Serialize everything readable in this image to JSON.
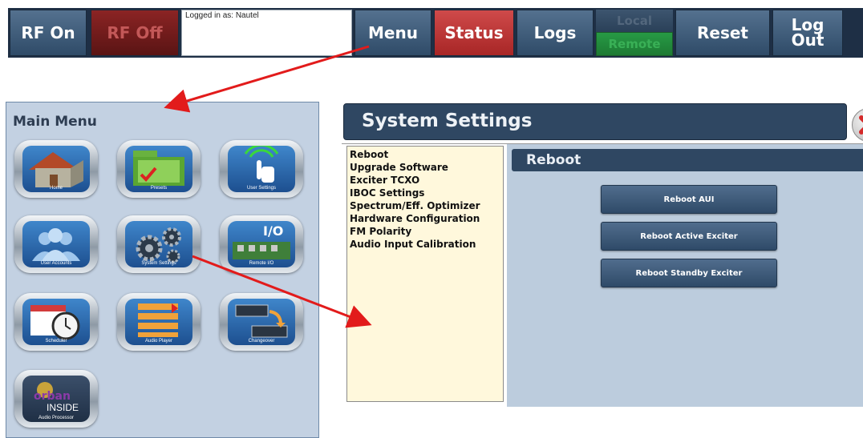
{
  "topbar": {
    "rf_on": "RF On",
    "rf_off": "RF Off",
    "logged_in": "Logged in as: Nautel",
    "menu": "Menu",
    "status": "Status",
    "logs": "Logs",
    "local": "Local",
    "remote": "Remote",
    "reset": "Reset",
    "logout_line1": "Log",
    "logout_line2": "Out"
  },
  "main_menu": {
    "title": "Main Menu",
    "tiles": {
      "home": "Home",
      "presets": "Presets",
      "user_settings": "User Settings",
      "user_accounts": "User Accounts",
      "system_settings": "System Settings",
      "remote_io": "Remote I/O",
      "io_text": "I/O",
      "scheduler": "Scheduler",
      "audio_player": "Audio Player",
      "changeover": "Changeover",
      "audio_processor": "Audio Processor",
      "orban_text": "orban",
      "inside_text": "INSIDE"
    }
  },
  "system_settings": {
    "title": "System Settings",
    "items": [
      "Reboot",
      "Upgrade Software",
      "Exciter TCXO",
      "IBOC Settings",
      "Spectrum/Eff. Optimizer",
      "Hardware Configuration",
      "FM Polarity",
      "Audio Input Calibration"
    ],
    "section_title": "Reboot",
    "buttons": {
      "reboot_aui": "Reboot AUI",
      "reboot_active": "Reboot Active Exciter",
      "reboot_standby": "Reboot Standby Exciter"
    }
  },
  "colors": {
    "arrow": "#e21b1b",
    "status_red": "#c53a3a",
    "remote_green": "#229a40",
    "nav_blue": "#2f4762"
  }
}
